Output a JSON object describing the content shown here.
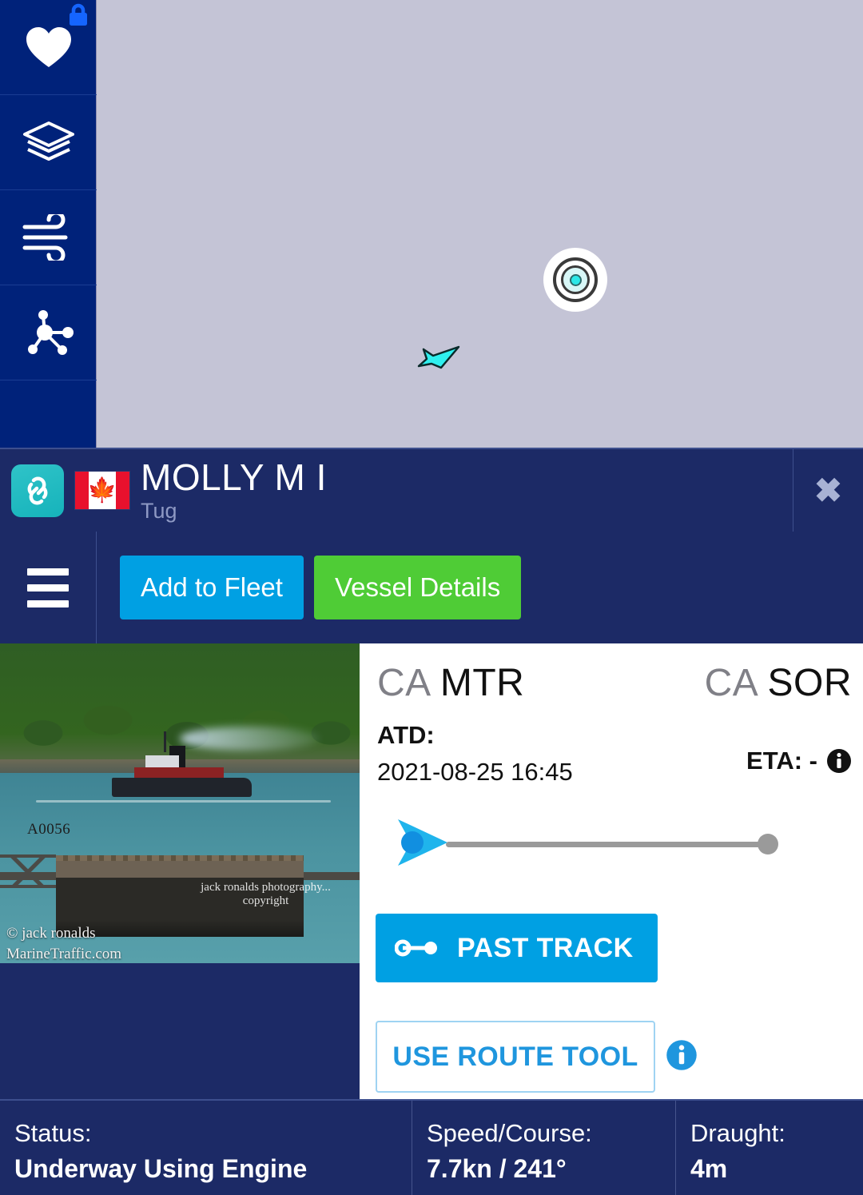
{
  "map": {
    "background_color": "#c4c4d6",
    "selected_vessel_marker": "concentric-target-marker",
    "nearby_vessel_marker": "cyan-vessel-arrow",
    "sidebar": {
      "items": [
        {
          "icon": "heart-icon",
          "name": "my-fleet",
          "locked": true,
          "lock_icon": "lock-icon"
        },
        {
          "icon": "layers-icon",
          "name": "map-layers",
          "locked": false
        },
        {
          "icon": "wind-icon",
          "name": "weather-wind",
          "locked": false
        },
        {
          "icon": "network-nodes-icon",
          "name": "network-density",
          "locked": false
        }
      ]
    }
  },
  "vessel_header": {
    "link_icon": "chain-link-icon",
    "flag": "canada-flag",
    "flag_country": "CA",
    "name": "MOLLY M I",
    "type": "Tug",
    "close_label": "✖",
    "close_name": "close-icon"
  },
  "toolbar": {
    "menu_icon": "hamburger-menu-icon",
    "add_to_fleet_label": "Add to Fleet",
    "vessel_details_label": "Vessel Details",
    "add_to_fleet_color": "#00a0e3",
    "vessel_details_color": "#4fcc36"
  },
  "photo": {
    "caption_id": "A0056",
    "watermark_line1": "jack ronalds photography...",
    "watermark_line2": "copyright",
    "credit": "© jack ronalds",
    "source": "MarineTraffic.com"
  },
  "voyage": {
    "from_country": "CA",
    "from_port": "MTR",
    "to_country": "CA",
    "to_port": "SOR",
    "atd_label": "ATD:",
    "atd_value": "2021-08-25 16:45",
    "eta_label": "ETA: -",
    "eta_info_icon": "info-icon",
    "progress_percent": 0,
    "past_track_label": "PAST TRACK",
    "past_track_icon": "track-line-icon",
    "route_tool_label": "USE ROUTE TOOL",
    "route_tool_info_icon": "info-icon"
  },
  "status": {
    "status_label": "Status:",
    "status_value": "Underway Using Engine",
    "speed_course_label": "Speed/Course:",
    "speed_course_value": "7.7kn / 241°",
    "draught_label": "Draught:",
    "draught_value": "4m"
  }
}
